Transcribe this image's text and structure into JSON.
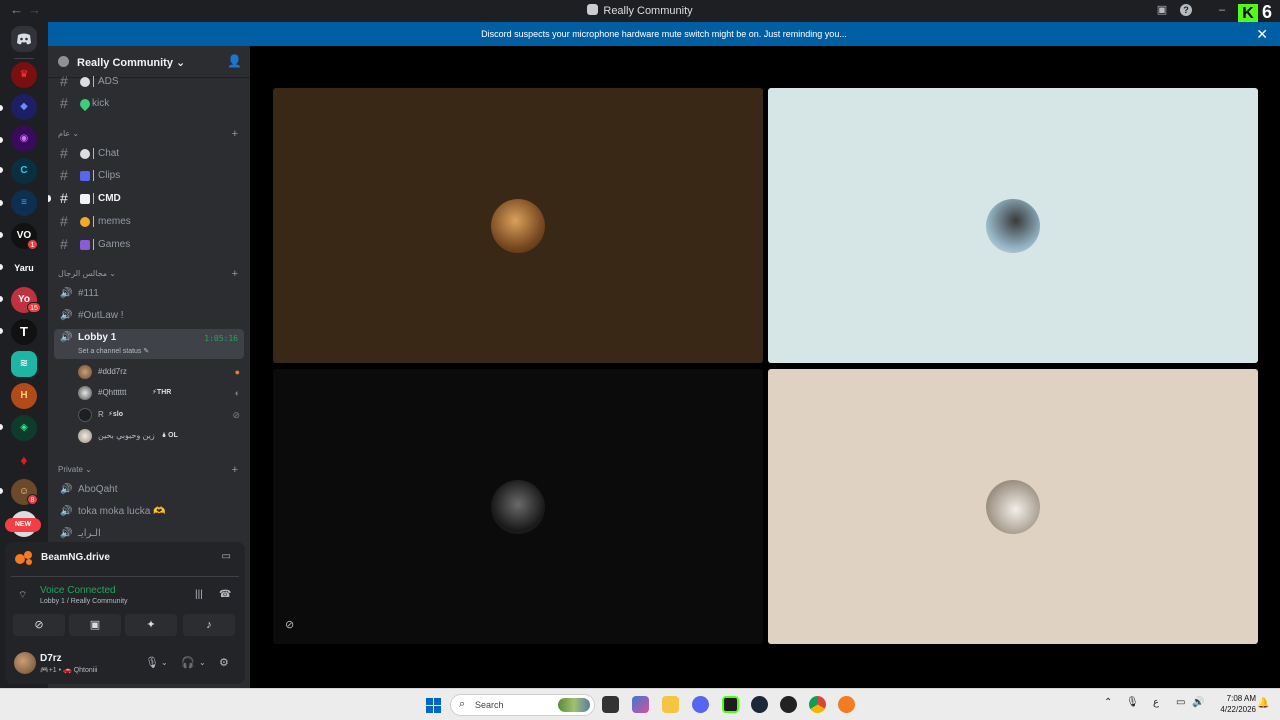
{
  "window": {
    "title": "Really Community",
    "kick_badge_count": "6",
    "kick_logo_letter": "K"
  },
  "notice": {
    "text": "Discord suspects your microphone hardware mute switch might be on. Just reminding you...",
    "close": "✕"
  },
  "rail": {
    "new_badge": "NEW",
    "badges": [
      "1",
      "15",
      "8"
    ]
  },
  "guild": {
    "name": "Really Community ⌄"
  },
  "channels": {
    "top": [
      {
        "name": "ADS"
      },
      {
        "name": "kick"
      }
    ],
    "category_general": {
      "name": "عام ⌄"
    },
    "general": [
      {
        "name": "Chat"
      },
      {
        "name": "Clips"
      },
      {
        "name": "CMD"
      },
      {
        "name": "memes"
      },
      {
        "name": "Games"
      }
    ],
    "category_voice": {
      "name": "مجالس الرجال ⌄"
    },
    "voice": [
      {
        "name": "#111"
      },
      {
        "name": "#OutLaw !"
      }
    ],
    "lobby": {
      "name": "Lobby 1",
      "timer": "1:05:16",
      "status": "Set a channel status ✎"
    },
    "voice_users": [
      {
        "name": "#ddd7rz",
        "tag": ""
      },
      {
        "name": "#Qhtttttt",
        "tag": "⚡THR"
      },
      {
        "name": "R",
        "tag": "⚡slo"
      },
      {
        "name": "زين وحبوبي بحين",
        "tag": "🌢 OL"
      }
    ],
    "category_private": {
      "name": "Private ⌄"
    },
    "private": [
      {
        "name": "AboQaht"
      },
      {
        "name": "toka moka lucka 🫶"
      },
      {
        "name": "الـرايـ"
      }
    ]
  },
  "game": {
    "name": "BeamNG.drive"
  },
  "voice_panel": {
    "status": "Voice Connected",
    "channel": "Lobby 1 / Really Community"
  },
  "user": {
    "name": "D7rz",
    "status": "🎮+1 • 🚗 Qhtoniii"
  },
  "taskbar": {
    "search_label": "Search",
    "time": "7:08 AM",
    "date": "4/22/2026",
    "lang": "ع"
  },
  "colors": {
    "accent": "#005fa3",
    "online": "#23a559",
    "danger": "#f23f43",
    "kick": "#53fc18"
  }
}
